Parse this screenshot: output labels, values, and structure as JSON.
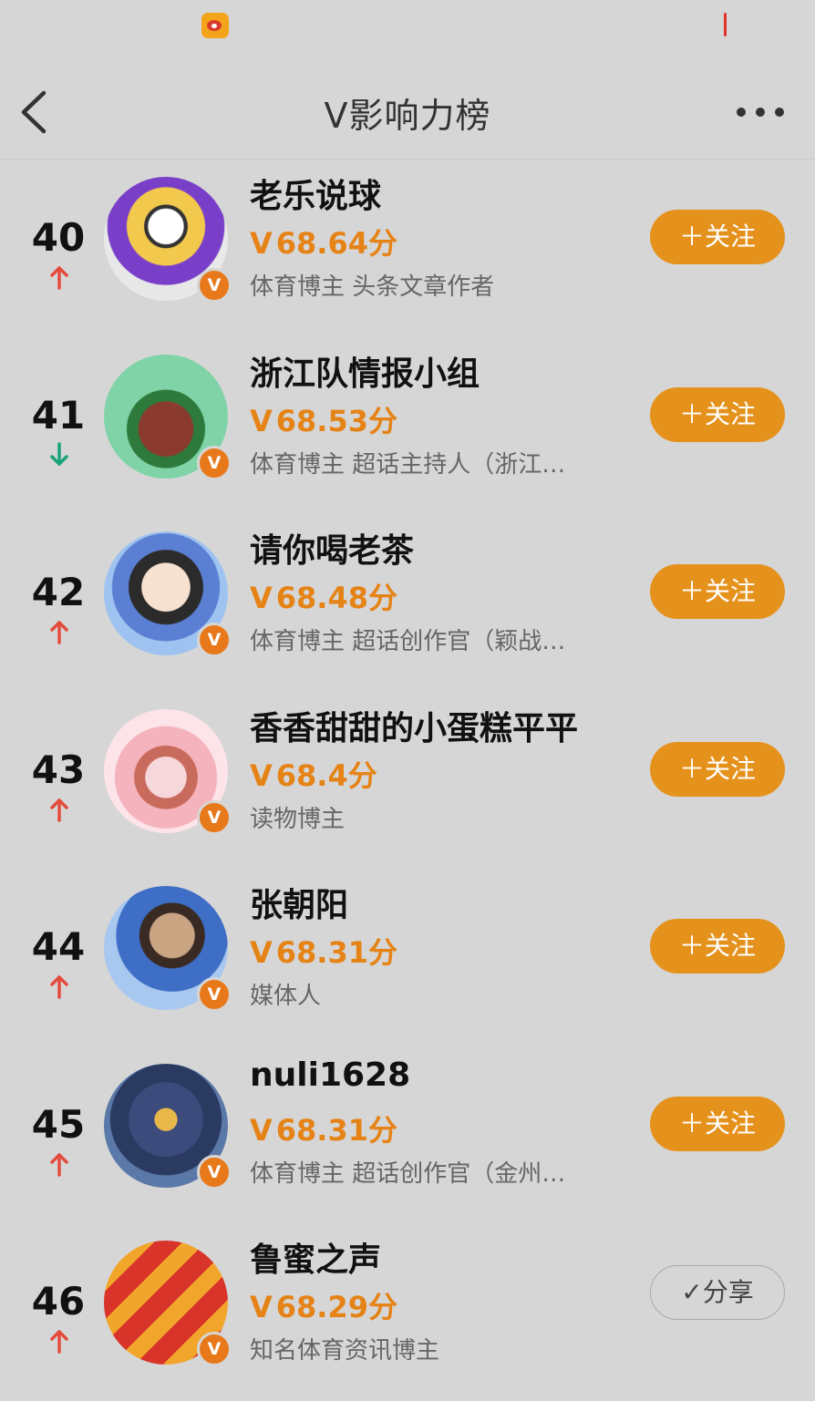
{
  "header": {
    "title": "V影响力榜"
  },
  "colors": {
    "accent": "#e5921c",
    "score": "#e58316",
    "trend_up": "#e34b3c",
    "trend_down": "#1aa37a"
  },
  "rows": [
    {
      "rank": "40",
      "trend": "up",
      "name": "老乐说球",
      "score": "68.64分",
      "desc": "体育博主 头条文章作者",
      "action": "＋关注"
    },
    {
      "rank": "41",
      "trend": "down",
      "name": "浙江队情报小组",
      "score": "68.53分",
      "desc": "体育博主 超话主持人（浙江…",
      "action": "＋关注"
    },
    {
      "rank": "42",
      "trend": "up",
      "name": "请你喝老茶",
      "score": "68.48分",
      "desc": "体育博主 超话创作官（颖战…",
      "action": "＋关注"
    },
    {
      "rank": "43",
      "trend": "up",
      "name": "香香甜甜的小蛋糕平平",
      "score": "68.4分",
      "desc": "读物博主",
      "action": "＋关注"
    },
    {
      "rank": "44",
      "trend": "up",
      "name": "张朝阳",
      "score": "68.31分",
      "desc": "媒体人",
      "action": "＋关注"
    },
    {
      "rank": "45",
      "trend": "up",
      "name": "nuli1628",
      "score": "68.31分",
      "desc": "体育博主 超话创作官（金州…",
      "action": "＋关注"
    },
    {
      "rank": "46",
      "trend": "up",
      "name": "鲁蜜之声",
      "score": "68.29分",
      "desc": "知名体育资讯博主",
      "action": "✓分享"
    }
  ],
  "badge": {
    "mark": "V"
  },
  "score_prefix": "V"
}
